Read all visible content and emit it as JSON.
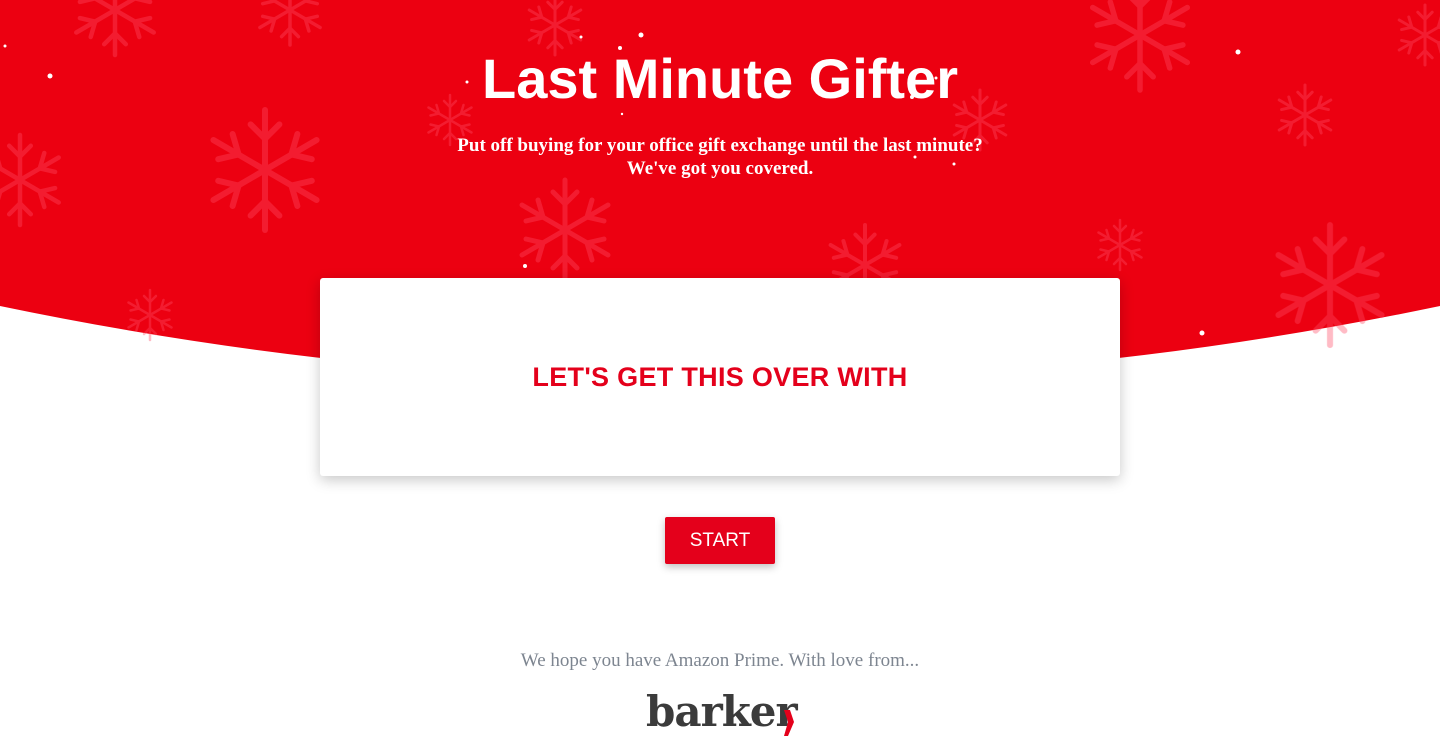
{
  "header": {
    "title": "Last Minute Gifter",
    "subtitle_line1": "Put off buying for your office gift exchange until the last minute?",
    "subtitle_line2": "We've got you covered."
  },
  "card": {
    "heading": "LET'S GET THIS OVER WITH"
  },
  "actions": {
    "start_label": "START"
  },
  "footer": {
    "text": "We hope you have Amazon Prime. With love from...",
    "logo_text": "barker"
  },
  "colors": {
    "brand_red": "#e4001b",
    "hero_red": "#ec0011",
    "footer_text": "#7d8590",
    "logo_dark": "#3b3b3b"
  },
  "icons": {
    "background_decoration": "snowflake-icon",
    "logo_mark": "red-comma-mark"
  }
}
